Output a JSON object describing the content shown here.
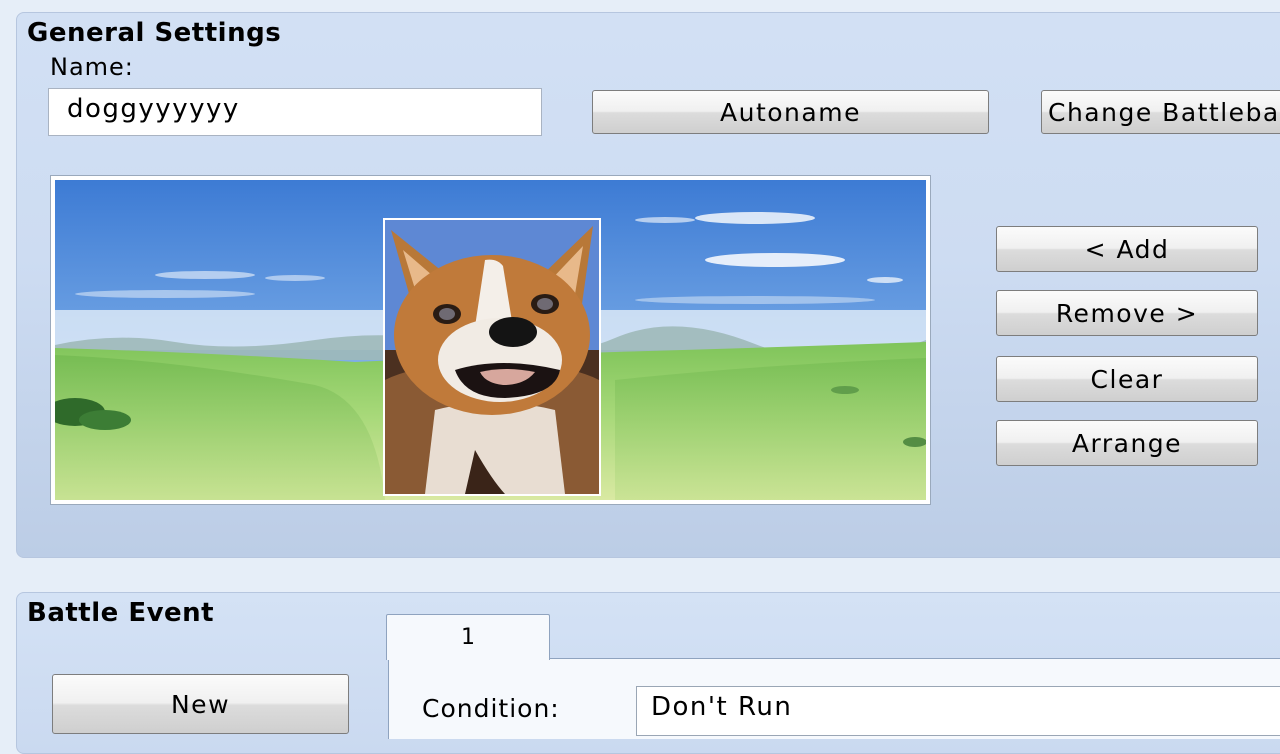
{
  "general_settings": {
    "title": "General Settings",
    "name_label": "Name:",
    "name_value": "doggyyyyyy",
    "autoname_button": "Autoname",
    "change_battleback_button": "Change Battleback",
    "add_button": "< Add",
    "remove_button": "Remove >",
    "clear_button": "Clear",
    "arrange_button": "Arrange"
  },
  "battle_event": {
    "title": "Battle Event",
    "new_button": "New",
    "tabs": [
      {
        "label": "1"
      }
    ],
    "condition_label": "Condition:",
    "condition_value": "Don't Run"
  },
  "icons": {
    "preview_background": "grassland-landscape",
    "enemy_sprite": "corgi-dog"
  },
  "colors": {
    "panel": "#cddcf2",
    "button_face": "#f0f0f0",
    "sky": "#4a83d6",
    "grass": "#8fd06b"
  }
}
